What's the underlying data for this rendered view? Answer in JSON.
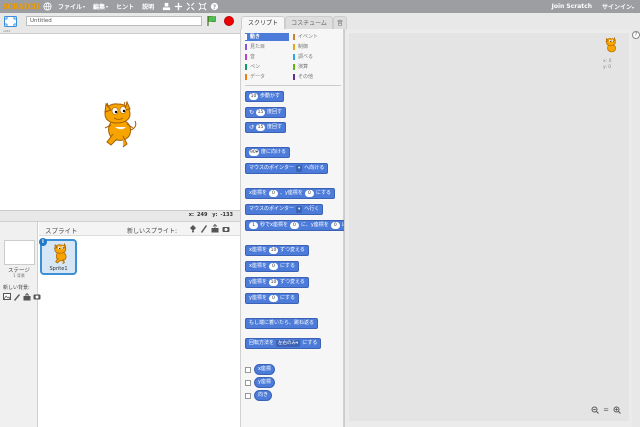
{
  "topbar": {
    "logo": "SCRATCH",
    "menus": [
      {
        "label": "ファイル",
        "caret": "▾"
      },
      {
        "label": "編集",
        "caret": "▾"
      },
      {
        "label": "ヒント",
        "caret": ""
      },
      {
        "label": "説明",
        "caret": ""
      }
    ],
    "join_label": "Join Scratch",
    "signin_label": "サインイン",
    "signin_caret": "▾"
  },
  "project": {
    "title_value": "Untitled",
    "version": "v461"
  },
  "stage": {
    "x_label": "x:",
    "x_value": "249",
    "y_label": "y:",
    "y_value": "-133"
  },
  "sprites": {
    "header": "スプライト",
    "new_sprite_label": "新しいスプライト:",
    "stage_label": "ステージ",
    "backdrop_count": "1 背景",
    "new_backdrop_label": "新しい背景:",
    "items": [
      {
        "name": "Sprite1",
        "info": "i"
      }
    ]
  },
  "tabs": [
    {
      "label": "スクリプト",
      "active": true
    },
    {
      "label": "コスチューム",
      "active": false
    },
    {
      "label": "音",
      "active": false
    }
  ],
  "categories": [
    {
      "label": "動き",
      "color": "#4c7bd9",
      "selected": true
    },
    {
      "label": "見た目",
      "color": "#8a55d7",
      "selected": false
    },
    {
      "label": "音",
      "color": "#bb42c3",
      "selected": false
    },
    {
      "label": "ペン",
      "color": "#0e9a6c",
      "selected": false
    },
    {
      "label": "データ",
      "color": "#ee7d16",
      "selected": false
    },
    {
      "label": "イベント",
      "color": "#c88330",
      "selected": false
    },
    {
      "label": "制御",
      "color": "#e1a91a",
      "selected": false
    },
    {
      "label": "調べる",
      "color": "#2ca5e2",
      "selected": false
    },
    {
      "label": "演算",
      "color": "#5cb712",
      "selected": false
    },
    {
      "label": "その他",
      "color": "#632d99",
      "selected": false
    }
  ],
  "blocks": {
    "move": {
      "value": "10",
      "text": "歩動かす"
    },
    "turn_right": {
      "value": "15",
      "text": "度回す"
    },
    "turn_left": {
      "value": "15",
      "text": "度回す"
    },
    "point_direction": {
      "value": "90▾",
      "text": "度に向ける"
    },
    "point_towards": {
      "text": "マウスのポインター",
      "caret": "▾",
      "suffix": "へ向ける"
    },
    "goto_xy": {
      "p1": "x座標を",
      "x": "0",
      "p2": "、y座標を",
      "y": "0",
      "p3": "にする"
    },
    "goto": {
      "text": "マウスのポインター",
      "caret": "▾",
      "suffix": "へ行く"
    },
    "glide": {
      "secs": "1",
      "p1": "秒でx座標を",
      "x": "0",
      "p2": "に、y座標を",
      "y": "0",
      "p3": "に"
    },
    "change_x": {
      "p1": "x座標を",
      "v": "10",
      "p2": "ずつ変える"
    },
    "set_x": {
      "p1": "x座標を",
      "v": "0",
      "p2": "にする"
    },
    "change_y": {
      "p1": "y座標を",
      "v": "10",
      "p2": "ずつ変える"
    },
    "set_y": {
      "p1": "y座標を",
      "v": "0",
      "p2": "にする"
    },
    "bounce": {
      "text": "もし端に着いたら、跳ね返る"
    },
    "rotation_style": {
      "p1": "回転方法を",
      "v": "左右のみ",
      "caret": "▾",
      "p2": "にする"
    },
    "reporters": [
      {
        "label": "x座標"
      },
      {
        "label": "y座標"
      },
      {
        "label": "向き"
      }
    ]
  },
  "script_area": {
    "x_label": "x: 0",
    "y_label": "y: 0",
    "zoom_out": "−",
    "zoom_reset": "=",
    "zoom_in": "+"
  },
  "help": "?"
}
